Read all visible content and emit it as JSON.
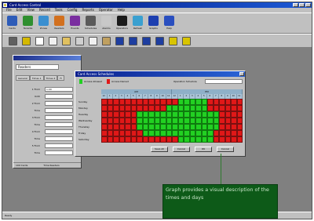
{
  "window": {
    "title": "Card Access Control",
    "menus": [
      "File",
      "Edit",
      "View",
      "Record",
      "Tools",
      "Config",
      "Reports",
      "Operator",
      "Help"
    ]
  },
  "toolbar1": [
    {
      "label": "Cards",
      "icon": "cards-icon",
      "color": "#2e5cb8"
    },
    {
      "label": "Tenants",
      "icon": "tenants-icon",
      "color": "#2f8f2f"
    },
    {
      "label": "Zones",
      "icon": "zones-icon",
      "color": "#3a8fd0"
    },
    {
      "label": "Readers",
      "icon": "readers-icon",
      "color": "#d2701e"
    },
    {
      "label": "Events",
      "icon": "events-icon",
      "color": "#7a2ea0"
    },
    {
      "label": "Schedules",
      "icon": "schedules-icon",
      "color": "#5a5a5a"
    },
    {
      "label": "Alarms",
      "icon": "alarms-icon",
      "color": "#c8c8c8"
    },
    {
      "label": "Operators",
      "icon": "operators-icon",
      "color": "#1a1a1a"
    },
    {
      "label": "Refresh",
      "icon": "refresh-icon",
      "color": "#3aa0d0"
    },
    {
      "label": "Graphs",
      "icon": "graphs-icon",
      "color": "#1d3fb0"
    },
    {
      "label": "Help",
      "icon": "help-icon",
      "color": "#2a4fbf"
    }
  ],
  "toolbar2": [
    {
      "icon": "monitor-icon",
      "color": "#606060"
    },
    {
      "icon": "print-icon",
      "color": "#d4b800"
    },
    {
      "icon": "note-icon",
      "color": "#ffffff"
    },
    {
      "icon": "new-icon",
      "color": "#f0f0f0"
    },
    {
      "icon": "open-icon",
      "color": "#e0c060"
    },
    {
      "icon": "cut-icon",
      "color": "#d0d0d0"
    },
    {
      "icon": "copy-icon",
      "color": "#f0f0f0"
    },
    {
      "icon": "paste-icon",
      "color": "#c0a060"
    },
    {
      "icon": "first-record-icon",
      "color": "#1e3ea0"
    },
    {
      "icon": "previous-record-icon",
      "color": "#1e3ea0"
    },
    {
      "icon": "next-record-icon",
      "color": "#1e3ea0"
    },
    {
      "icon": "last-record-icon",
      "color": "#1e3ea0"
    },
    {
      "icon": "add-record-icon",
      "color": "#d8c400"
    },
    {
      "icon": "delete-record-icon",
      "color": "#d8c400"
    }
  ],
  "bg_window": {
    "combo_value": "Readers",
    "tabs": [
      "General",
      "Times 1",
      "Times 2",
      "Fl"
    ],
    "fields": [
      {
        "label": "1 From",
        "value": "1:00"
      },
      {
        "label": "Until",
        "value": ""
      },
      {
        "label": "2 From",
        "value": ""
      },
      {
        "label": "Time",
        "value": ""
      },
      {
        "label": "3 From",
        "value": ""
      },
      {
        "label": "Time",
        "value": ""
      },
      {
        "label": "4 From",
        "value": ""
      },
      {
        "label": "Time",
        "value": ""
      },
      {
        "label": "5 From",
        "value": ""
      },
      {
        "label": "Time",
        "value": ""
      }
    ],
    "status_left": "100 Cards",
    "status_right": "Time Readers"
  },
  "dialog": {
    "title": "Card Access Schedules",
    "legend_allowed": "Access Allowed",
    "legend_denied": "Access Denied",
    "legend_allowed_color": "#22d022",
    "legend_denied_color": "#e01818",
    "operator_label": "Operation Schedule",
    "ampm": [
      "AM",
      "PM"
    ],
    "hours": [
      "12",
      "1",
      "2",
      "3",
      "4",
      "5",
      "6",
      "7",
      "8",
      "9",
      "10",
      "11",
      "12",
      "1",
      "2",
      "3",
      "4",
      "5",
      "6",
      "7",
      "8",
      "9",
      "10",
      "11"
    ],
    "days": [
      "Sunday",
      "Monday",
      "Tuesday",
      "Wednesday",
      "Thursday",
      "Friday",
      "Saturday"
    ],
    "schedule": [
      [
        0,
        0,
        0,
        0,
        0,
        0,
        0,
        0,
        0,
        0,
        0,
        0,
        0,
        1,
        1,
        1,
        1,
        1,
        0,
        0,
        0,
        0,
        0,
        0
      ],
      [
        0,
        0,
        0,
        0,
        0,
        0,
        0,
        0,
        0,
        0,
        0,
        1,
        1,
        1,
        1,
        1,
        1,
        1,
        0,
        0,
        0,
        0,
        0,
        0
      ],
      [
        0,
        0,
        0,
        0,
        0,
        0,
        1,
        1,
        1,
        1,
        1,
        1,
        1,
        1,
        1,
        1,
        1,
        1,
        1,
        1,
        0,
        0,
        0,
        0
      ],
      [
        0,
        0,
        0,
        0,
        0,
        0,
        1,
        1,
        1,
        1,
        1,
        1,
        1,
        1,
        1,
        1,
        1,
        1,
        1,
        1,
        0,
        0,
        0,
        0
      ],
      [
        0,
        0,
        0,
        0,
        0,
        0,
        1,
        1,
        1,
        1,
        1,
        1,
        1,
        1,
        1,
        1,
        1,
        1,
        1,
        1,
        0,
        0,
        0,
        0
      ],
      [
        0,
        0,
        0,
        0,
        0,
        0,
        0,
        1,
        1,
        1,
        1,
        1,
        1,
        1,
        1,
        1,
        1,
        1,
        1,
        0,
        0,
        0,
        0,
        0
      ],
      [
        0,
        0,
        0,
        0,
        0,
        0,
        0,
        0,
        0,
        0,
        0,
        0,
        0,
        1,
        1,
        1,
        1,
        1,
        1,
        0,
        0,
        0,
        0,
        0
      ]
    ],
    "buttons": [
      "Save All",
      "Cancel",
      "OK",
      "Cancel"
    ]
  },
  "callout": {
    "text": "Graph provides a visual description of the times and days"
  },
  "statusbar": {
    "text": "Ready"
  }
}
